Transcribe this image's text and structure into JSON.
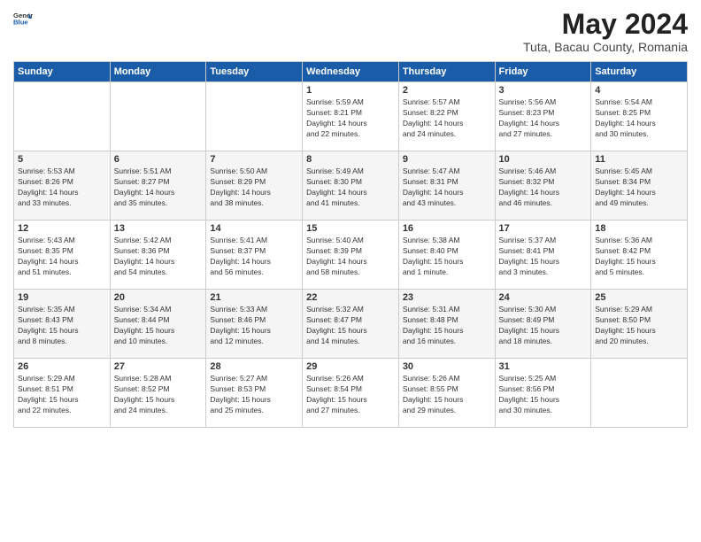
{
  "logo": {
    "general": "General",
    "blue": "Blue"
  },
  "title": "May 2024",
  "location": "Tuta, Bacau County, Romania",
  "weekdays": [
    "Sunday",
    "Monday",
    "Tuesday",
    "Wednesday",
    "Thursday",
    "Friday",
    "Saturday"
  ],
  "weeks": [
    [
      {
        "day": "",
        "content": ""
      },
      {
        "day": "",
        "content": ""
      },
      {
        "day": "",
        "content": ""
      },
      {
        "day": "1",
        "content": "Sunrise: 5:59 AM\nSunset: 8:21 PM\nDaylight: 14 hours\nand 22 minutes."
      },
      {
        "day": "2",
        "content": "Sunrise: 5:57 AM\nSunset: 8:22 PM\nDaylight: 14 hours\nand 24 minutes."
      },
      {
        "day": "3",
        "content": "Sunrise: 5:56 AM\nSunset: 8:23 PM\nDaylight: 14 hours\nand 27 minutes."
      },
      {
        "day": "4",
        "content": "Sunrise: 5:54 AM\nSunset: 8:25 PM\nDaylight: 14 hours\nand 30 minutes."
      }
    ],
    [
      {
        "day": "5",
        "content": "Sunrise: 5:53 AM\nSunset: 8:26 PM\nDaylight: 14 hours\nand 33 minutes."
      },
      {
        "day": "6",
        "content": "Sunrise: 5:51 AM\nSunset: 8:27 PM\nDaylight: 14 hours\nand 35 minutes."
      },
      {
        "day": "7",
        "content": "Sunrise: 5:50 AM\nSunset: 8:29 PM\nDaylight: 14 hours\nand 38 minutes."
      },
      {
        "day": "8",
        "content": "Sunrise: 5:49 AM\nSunset: 8:30 PM\nDaylight: 14 hours\nand 41 minutes."
      },
      {
        "day": "9",
        "content": "Sunrise: 5:47 AM\nSunset: 8:31 PM\nDaylight: 14 hours\nand 43 minutes."
      },
      {
        "day": "10",
        "content": "Sunrise: 5:46 AM\nSunset: 8:32 PM\nDaylight: 14 hours\nand 46 minutes."
      },
      {
        "day": "11",
        "content": "Sunrise: 5:45 AM\nSunset: 8:34 PM\nDaylight: 14 hours\nand 49 minutes."
      }
    ],
    [
      {
        "day": "12",
        "content": "Sunrise: 5:43 AM\nSunset: 8:35 PM\nDaylight: 14 hours\nand 51 minutes."
      },
      {
        "day": "13",
        "content": "Sunrise: 5:42 AM\nSunset: 8:36 PM\nDaylight: 14 hours\nand 54 minutes."
      },
      {
        "day": "14",
        "content": "Sunrise: 5:41 AM\nSunset: 8:37 PM\nDaylight: 14 hours\nand 56 minutes."
      },
      {
        "day": "15",
        "content": "Sunrise: 5:40 AM\nSunset: 8:39 PM\nDaylight: 14 hours\nand 58 minutes."
      },
      {
        "day": "16",
        "content": "Sunrise: 5:38 AM\nSunset: 8:40 PM\nDaylight: 15 hours\nand 1 minute."
      },
      {
        "day": "17",
        "content": "Sunrise: 5:37 AM\nSunset: 8:41 PM\nDaylight: 15 hours\nand 3 minutes."
      },
      {
        "day": "18",
        "content": "Sunrise: 5:36 AM\nSunset: 8:42 PM\nDaylight: 15 hours\nand 5 minutes."
      }
    ],
    [
      {
        "day": "19",
        "content": "Sunrise: 5:35 AM\nSunset: 8:43 PM\nDaylight: 15 hours\nand 8 minutes."
      },
      {
        "day": "20",
        "content": "Sunrise: 5:34 AM\nSunset: 8:44 PM\nDaylight: 15 hours\nand 10 minutes."
      },
      {
        "day": "21",
        "content": "Sunrise: 5:33 AM\nSunset: 8:46 PM\nDaylight: 15 hours\nand 12 minutes."
      },
      {
        "day": "22",
        "content": "Sunrise: 5:32 AM\nSunset: 8:47 PM\nDaylight: 15 hours\nand 14 minutes."
      },
      {
        "day": "23",
        "content": "Sunrise: 5:31 AM\nSunset: 8:48 PM\nDaylight: 15 hours\nand 16 minutes."
      },
      {
        "day": "24",
        "content": "Sunrise: 5:30 AM\nSunset: 8:49 PM\nDaylight: 15 hours\nand 18 minutes."
      },
      {
        "day": "25",
        "content": "Sunrise: 5:29 AM\nSunset: 8:50 PM\nDaylight: 15 hours\nand 20 minutes."
      }
    ],
    [
      {
        "day": "26",
        "content": "Sunrise: 5:29 AM\nSunset: 8:51 PM\nDaylight: 15 hours\nand 22 minutes."
      },
      {
        "day": "27",
        "content": "Sunrise: 5:28 AM\nSunset: 8:52 PM\nDaylight: 15 hours\nand 24 minutes."
      },
      {
        "day": "28",
        "content": "Sunrise: 5:27 AM\nSunset: 8:53 PM\nDaylight: 15 hours\nand 25 minutes."
      },
      {
        "day": "29",
        "content": "Sunrise: 5:26 AM\nSunset: 8:54 PM\nDaylight: 15 hours\nand 27 minutes."
      },
      {
        "day": "30",
        "content": "Sunrise: 5:26 AM\nSunset: 8:55 PM\nDaylight: 15 hours\nand 29 minutes."
      },
      {
        "day": "31",
        "content": "Sunrise: 5:25 AM\nSunset: 8:56 PM\nDaylight: 15 hours\nand 30 minutes."
      },
      {
        "day": "",
        "content": ""
      }
    ]
  ]
}
